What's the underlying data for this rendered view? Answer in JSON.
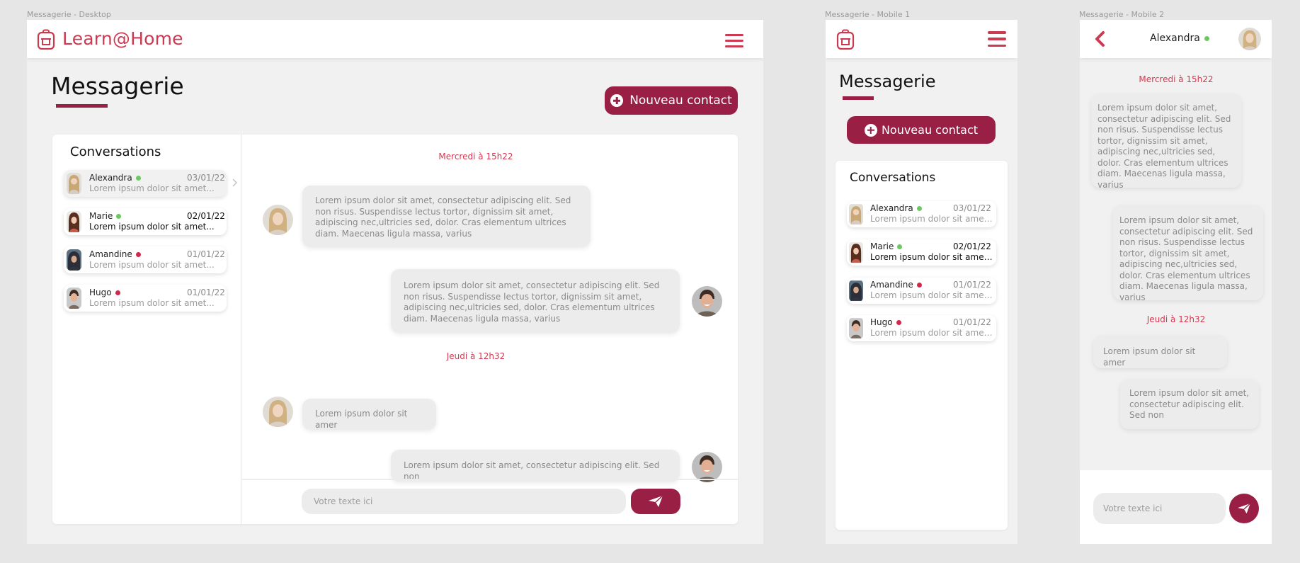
{
  "frames": {
    "desktop": "Messagerie - Desktop",
    "mobile1": "Messagerie - Mobile 1",
    "mobile2": "Messagerie - Mobile 2"
  },
  "brand": {
    "name": "Learn@Home",
    "color": "#cc3a52",
    "accent": "#9a1f45"
  },
  "page": {
    "title": "Messagerie",
    "new_contact": "Nouveau contact"
  },
  "conversations": {
    "title": "Conversations",
    "items": [
      {
        "name": "Alexandra",
        "status": "online",
        "date": "03/01/22",
        "preview": "Lorem  ipsum  dolor  sit amet..."
      },
      {
        "name": "Marie",
        "status": "online",
        "date": "02/01/22",
        "preview": "Lorem  ipsum  dolor  sit amet..."
      },
      {
        "name": "Amandine",
        "status": "offline",
        "date": "01/01/22",
        "preview": "Lorem  ipsum  dolor  sit amet..."
      },
      {
        "name": "Hugo",
        "status": "offline",
        "date": "01/01/22",
        "preview": "Lorem  ipsum  dolor  sit amet..."
      }
    ]
  },
  "chat": {
    "contact": "Alexandra",
    "timestamps": [
      "Mercredi à 15h22",
      "Jeudi à 12h32"
    ],
    "messages": [
      "Lorem  ipsum  dolor  sit amet,  consectetur  adipiscing  elit. Sed non risus. Suspendisse lectus tortor, dignissim sit amet, adipiscing nec,ultricies sed, dolor. Cras  elementum  ultrices  diam. Maecenas ligula massa, varius",
      "Lorem  ipsum  dolor  sit amet,  consectetur  adipiscing  elit. Sed non risus. Suspendisse lectus tortor, dignissim sit amet, adipiscing nec,ultricies sed, dolor. Cras  elementum  ultrices  diam. Maecenas ligula massa, varius",
      "Lorem  ipsum  dolor  sit amer",
      "Lorem  ipsum  dolor  sit amet,  consectetur  adipiscing  elit. Sed non"
    ],
    "input_placeholder": "Votre texte ici"
  },
  "icons": {
    "logo": "backpack-icon",
    "menu": "hamburger-menu-icon",
    "add": "plus-circle-icon",
    "send": "paper-plane-icon",
    "back": "chevron-left-icon",
    "next": "chevron-right-icon"
  }
}
